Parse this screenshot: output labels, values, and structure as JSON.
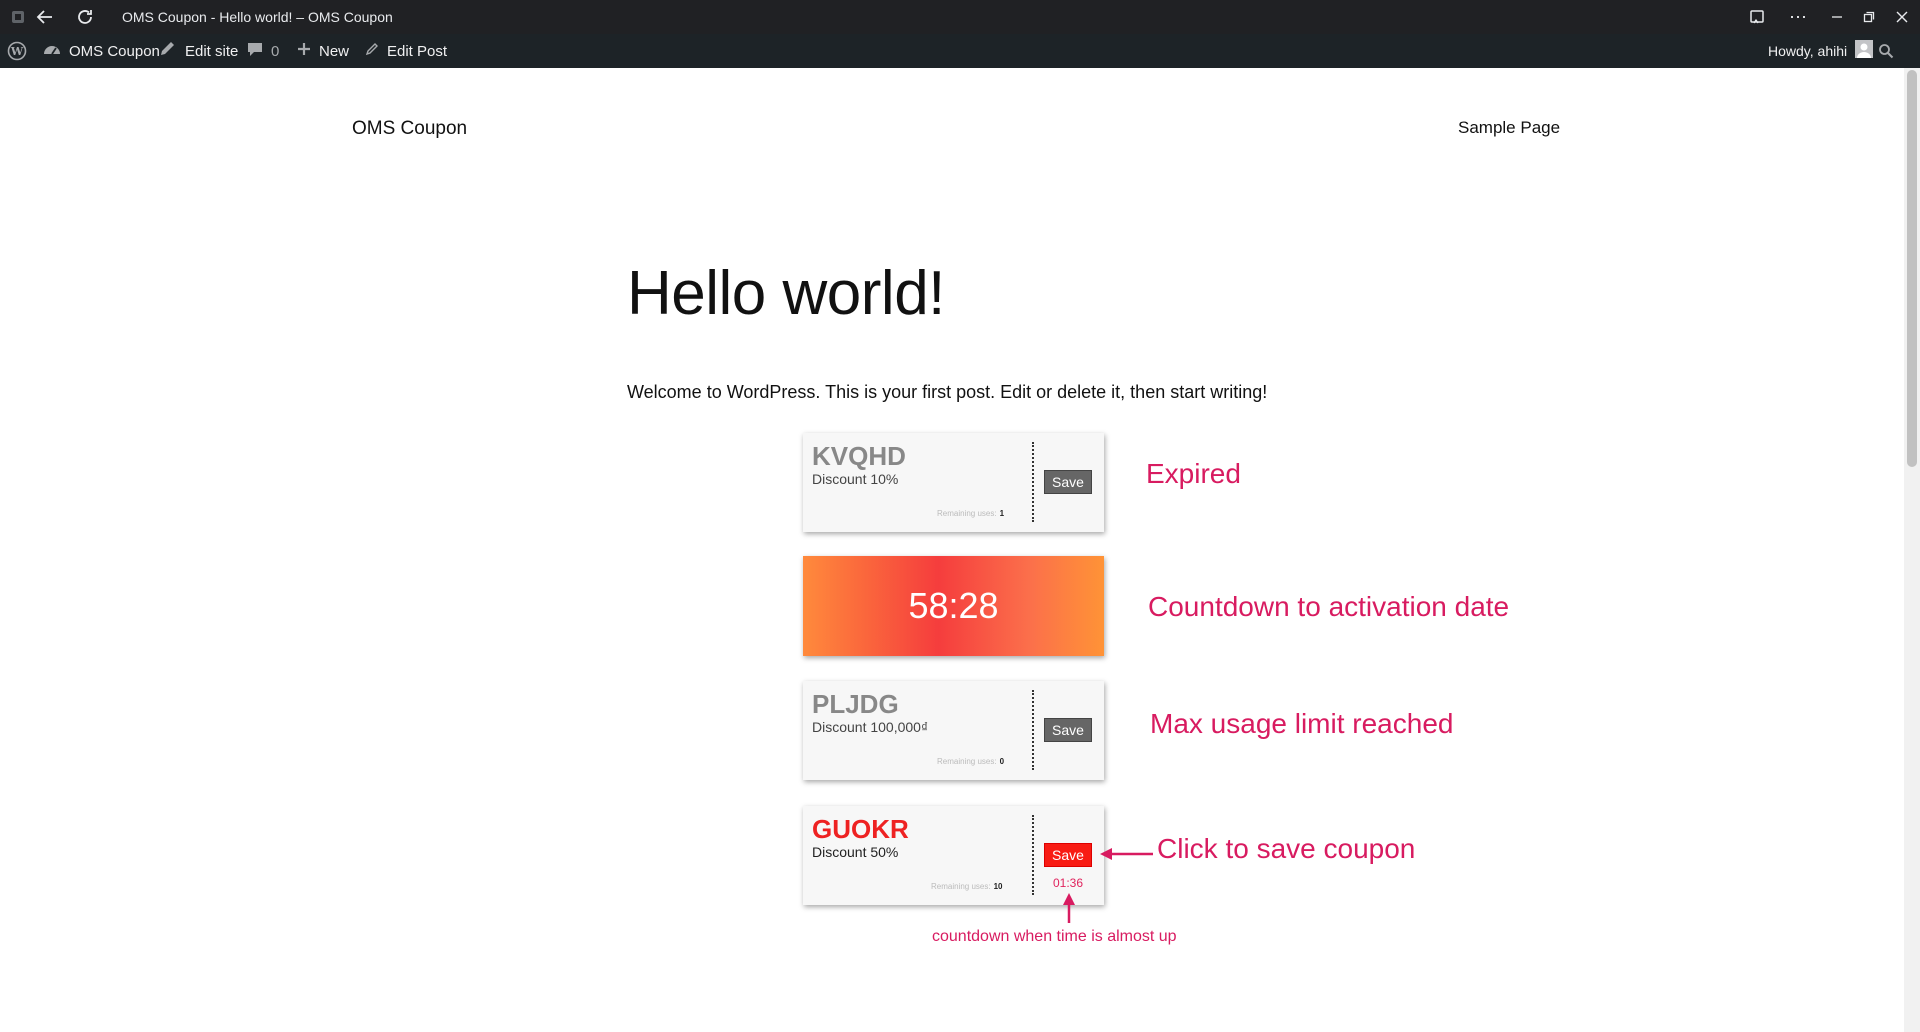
{
  "browser": {
    "tab_title": "OMS Coupon - Hello world! – OMS Coupon"
  },
  "admin_bar": {
    "site_name": "OMS Coupon",
    "edit_site": "Edit site",
    "comments_count": "0",
    "new_label": "New",
    "edit_post": "Edit Post",
    "greeting": "Howdy, ahihi"
  },
  "site": {
    "title": "OMS Coupon",
    "nav": [
      "Sample Page"
    ]
  },
  "post": {
    "title": "Hello world!",
    "body": "Welcome to WordPress. This is your first post. Edit or delete it, then start writing!"
  },
  "coupons": [
    {
      "code": "KVQHD",
      "discount": "Discount 10%",
      "remaining_label": "Remaining uses:",
      "remaining": "1",
      "save_label": "Save",
      "state": "expired"
    },
    {
      "code": "PLJDG",
      "discount": "Discount 100,000₫",
      "remaining_label": "Remaining uses:",
      "remaining": "0",
      "save_label": "Save",
      "state": "max-usage"
    },
    {
      "code": "GUOKR",
      "discount": "Discount 50%",
      "remaining_label": "Remaining uses:",
      "remaining": "10",
      "save_label": "Save",
      "state": "active",
      "timer": "01:36"
    }
  ],
  "countdown": {
    "value": "58:28"
  },
  "annotations": {
    "expired": "Expired",
    "countdown": "Countdown to activation date",
    "max_usage": "Max usage limit reached",
    "click_save": "Click to save coupon",
    "countdown_almost_up": "countdown when time is almost up"
  },
  "colors": {
    "annotation": "#d81b60",
    "active_code": "#ee2222",
    "save_active": "#f81c14",
    "save_disabled": "#666666"
  }
}
